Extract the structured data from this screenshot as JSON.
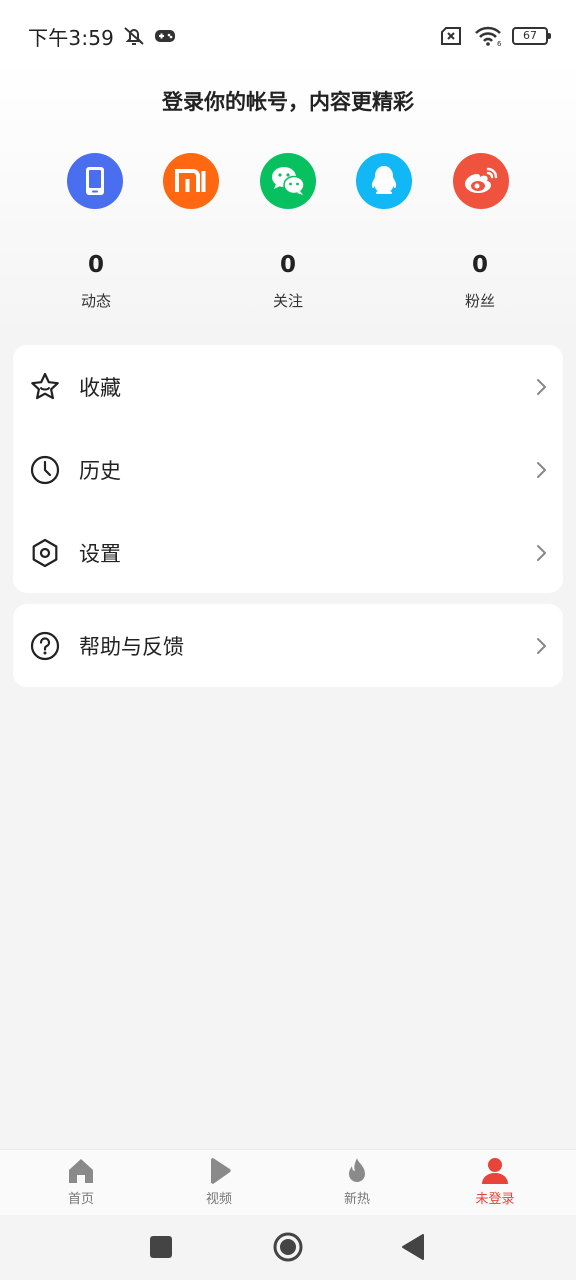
{
  "status_bar": {
    "time": "下午3:59",
    "battery": "67",
    "icons": [
      "mute-bell-icon",
      "gamepad-icon",
      "sim-off-icon",
      "wifi-icon",
      "battery-icon"
    ]
  },
  "login": {
    "prompt": "登录你的帐号，内容更精彩",
    "options": [
      {
        "name": "phone-login",
        "icon": "phone-icon",
        "color": "#4a6ef0"
      },
      {
        "name": "xiaomi-login",
        "icon": "mi-icon",
        "color": "#ff6710"
      },
      {
        "name": "wechat-login",
        "icon": "wechat-icon",
        "color": "#07c160"
      },
      {
        "name": "qq-login",
        "icon": "qq-icon",
        "color": "#12b7f5"
      },
      {
        "name": "weibo-login",
        "icon": "weibo-icon",
        "color": "#f0533d"
      }
    ]
  },
  "stats": [
    {
      "value": "0",
      "label": "动态"
    },
    {
      "value": "0",
      "label": "关注"
    },
    {
      "value": "0",
      "label": "粉丝"
    }
  ],
  "menu": {
    "group1": [
      {
        "label": "收藏",
        "icon": "star-icon"
      },
      {
        "label": "历史",
        "icon": "clock-icon"
      },
      {
        "label": "设置",
        "icon": "settings-hexagon-icon"
      }
    ],
    "group2": [
      {
        "label": "帮助与反馈",
        "icon": "help-circle-icon"
      }
    ]
  },
  "bottom_nav": {
    "items": [
      {
        "label": "首页",
        "icon": "home-icon"
      },
      {
        "label": "视频",
        "icon": "play-icon"
      },
      {
        "label": "新热",
        "icon": "flame-icon"
      },
      {
        "label": "未登录",
        "icon": "user-icon",
        "active": true
      }
    ],
    "active_color": "#e9443c"
  },
  "system_nav": [
    "recent-apps-icon",
    "home-circle-icon",
    "back-triangle-icon"
  ]
}
